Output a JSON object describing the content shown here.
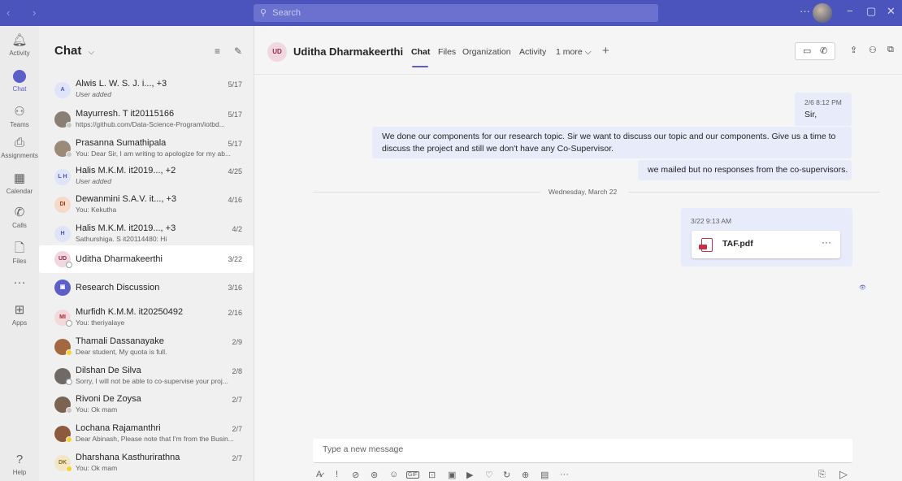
{
  "titlebar": {
    "search_placeholder": "Search",
    "back_glyph": "‹",
    "forward_glyph": "›",
    "more_glyph": "···",
    "minimize_glyph": "−",
    "maximize_glyph": "▢",
    "close_glyph": "✕",
    "bg_color": "#4b53bc"
  },
  "rail": {
    "items": [
      {
        "label": "Activity",
        "icon": "bell-icon",
        "glyph": "🔔︎"
      },
      {
        "label": "Chat",
        "icon": "chat-icon",
        "glyph": ""
      },
      {
        "label": "Teams",
        "icon": "teams-icon",
        "glyph": "⚇"
      },
      {
        "label": "Assignments",
        "icon": "assignments-icon",
        "glyph": "⎙"
      },
      {
        "label": "Calendar",
        "icon": "calendar-icon",
        "glyph": "▦"
      },
      {
        "label": "Calls",
        "icon": "phone-icon",
        "glyph": "✆"
      },
      {
        "label": "Files",
        "icon": "file-icon",
        "glyph": "🗋"
      },
      {
        "label": "",
        "icon": "more-icon",
        "glyph": "···"
      },
      {
        "label": "Apps",
        "icon": "apps-icon",
        "glyph": "⊞"
      },
      {
        "label": "Help",
        "icon": "help-icon",
        "glyph": "?"
      }
    ],
    "active_color": "#5b5fc7"
  },
  "chat_list": {
    "title": "Chat",
    "title_chevron": "⌵",
    "filter_glyph": "≡",
    "compose_glyph": "✎",
    "chats": [
      {
        "initials": "A",
        "name": "Alwis L. W. S. J. i..., +3",
        "preview": "User added",
        "date": "5/17",
        "italic": true,
        "avatar_bg": "#dfe4f8",
        "avatar_fg": "#4f52b2"
      },
      {
        "initials": "",
        "name": "Mayurresh. T it20115166",
        "preview": "https://github.com/Data-Science-Program/iotbd...",
        "date": "5/17",
        "italic": false,
        "avatar_bg": "#8a7f74",
        "avatar_fg": "#ffffff"
      },
      {
        "initials": "",
        "name": "Prasanna Sumathipala",
        "preview": "You: Dear Sir, I am writing to apologize for my ab...",
        "date": "5/17",
        "italic": false,
        "avatar_bg": "#9c8a78",
        "avatar_fg": "#ffffff"
      },
      {
        "initials": "L H",
        "name": "Halis M.K.M. it2019..., +2",
        "preview": "User added",
        "date": "4/25",
        "italic": true,
        "avatar_bg": "#dfe4f8",
        "avatar_fg": "#4f52b2"
      },
      {
        "initials": "DI",
        "name": "Dewanmini S.A.V. it..., +3",
        "preview": "You: Kekutha",
        "date": "4/16",
        "italic": false,
        "avatar_bg": "#f6d9c8",
        "avatar_fg": "#9a3c18"
      },
      {
        "initials": "H",
        "name": "Halis M.K.M. it2019..., +3",
        "preview": "Sathurshiga. S it20114480: Hi",
        "date": "4/2",
        "italic": false,
        "avatar_bg": "#dfe4f8",
        "avatar_fg": "#4f52b2"
      },
      {
        "initials": "UD",
        "name": "Uditha Dharmakeerthi",
        "preview": "",
        "date": "3/22",
        "italic": false,
        "avatar_bg": "#f1d7e0",
        "avatar_fg": "#8a2a53"
      },
      {
        "initials": "▣",
        "name": "Research Discussion",
        "preview": "",
        "date": "3/16",
        "italic": false,
        "avatar_bg": "#5b5fc7",
        "avatar_fg": "#ffffff"
      },
      {
        "initials": "MI",
        "name": "Murfidh K.M.M. it20250492",
        "preview": "You: theriyalaye",
        "date": "2/16",
        "italic": false,
        "avatar_bg": "#f3d8dc",
        "avatar_fg": "#a4262c"
      },
      {
        "initials": "",
        "name": "Thamali Dassanayake",
        "preview": "Dear student, My quota is full.",
        "date": "2/9",
        "italic": false,
        "avatar_bg": "#a3683f",
        "avatar_fg": "#ffffff"
      },
      {
        "initials": "",
        "name": "Dilshan De Silva",
        "preview": "Sorry, I will not be able to co-supervise your proj...",
        "date": "2/8",
        "italic": false,
        "avatar_bg": "#6f6a66",
        "avatar_fg": "#ffffff"
      },
      {
        "initials": "",
        "name": "Rivoni De Zoysa",
        "preview": "You: Ok mam",
        "date": "2/7",
        "italic": false,
        "avatar_bg": "#7b6251",
        "avatar_fg": "#ffffff"
      },
      {
        "initials": "",
        "name": "Lochana Rajamanthri",
        "preview": "Dear Abinash, Please note that I'm from the Busin...",
        "date": "2/7",
        "italic": false,
        "avatar_bg": "#8c5a3c",
        "avatar_fg": "#ffffff"
      },
      {
        "initials": "DK",
        "name": "Dharshana Kasthurirathna",
        "preview": "You: Ok mam",
        "date": "2/7",
        "italic": false,
        "avatar_bg": "#f3e6c8",
        "avatar_fg": "#8a6d17"
      }
    ]
  },
  "conversation": {
    "avatar_initials": "UD",
    "name": "Uditha Dharmakeerthi",
    "tabs": [
      "Chat",
      "Files",
      "Organization",
      "Activity",
      "1 more"
    ],
    "tab_more_chevron": "⌵",
    "add_tab_glyph": "+",
    "messages": {
      "m1_time": "2/6 8:12 PM",
      "m1_text": "Sir,",
      "m2_line1": "We done our components for our research topic. Sir we want to discuss our topic and our components. Give us a time to",
      "m2_line2": "discuss the project and still we don't have any Co-Supervisor.",
      "m3_text": "we mailed but no responses from the co-supervisors.",
      "divider": "Wednesday, March 22",
      "m4_time": "3/22 9:13 AM",
      "file_name": "TAF.pdf",
      "file_more": "···",
      "seen_glyph": "👁︎"
    },
    "compose_placeholder": "Type a new message",
    "bubble_color": "#e8ebfa"
  },
  "toolbar": {
    "format_glyph": "A̷",
    "attach_glyph": "⊘",
    "emoji_glyph": "☺",
    "gif_glyph": "GIF",
    "sticker_glyph": "⊡",
    "meet_glyph": "▶",
    "praise_glyph": "♡",
    "loop_glyph": "↻",
    "more_glyph": "···",
    "send_glyph": "▷",
    "video_glyph": "▭",
    "call_glyph": "✆",
    "share_glyph": "⇪",
    "people_glyph": "⚇",
    "popout_glyph": "⧉"
  }
}
